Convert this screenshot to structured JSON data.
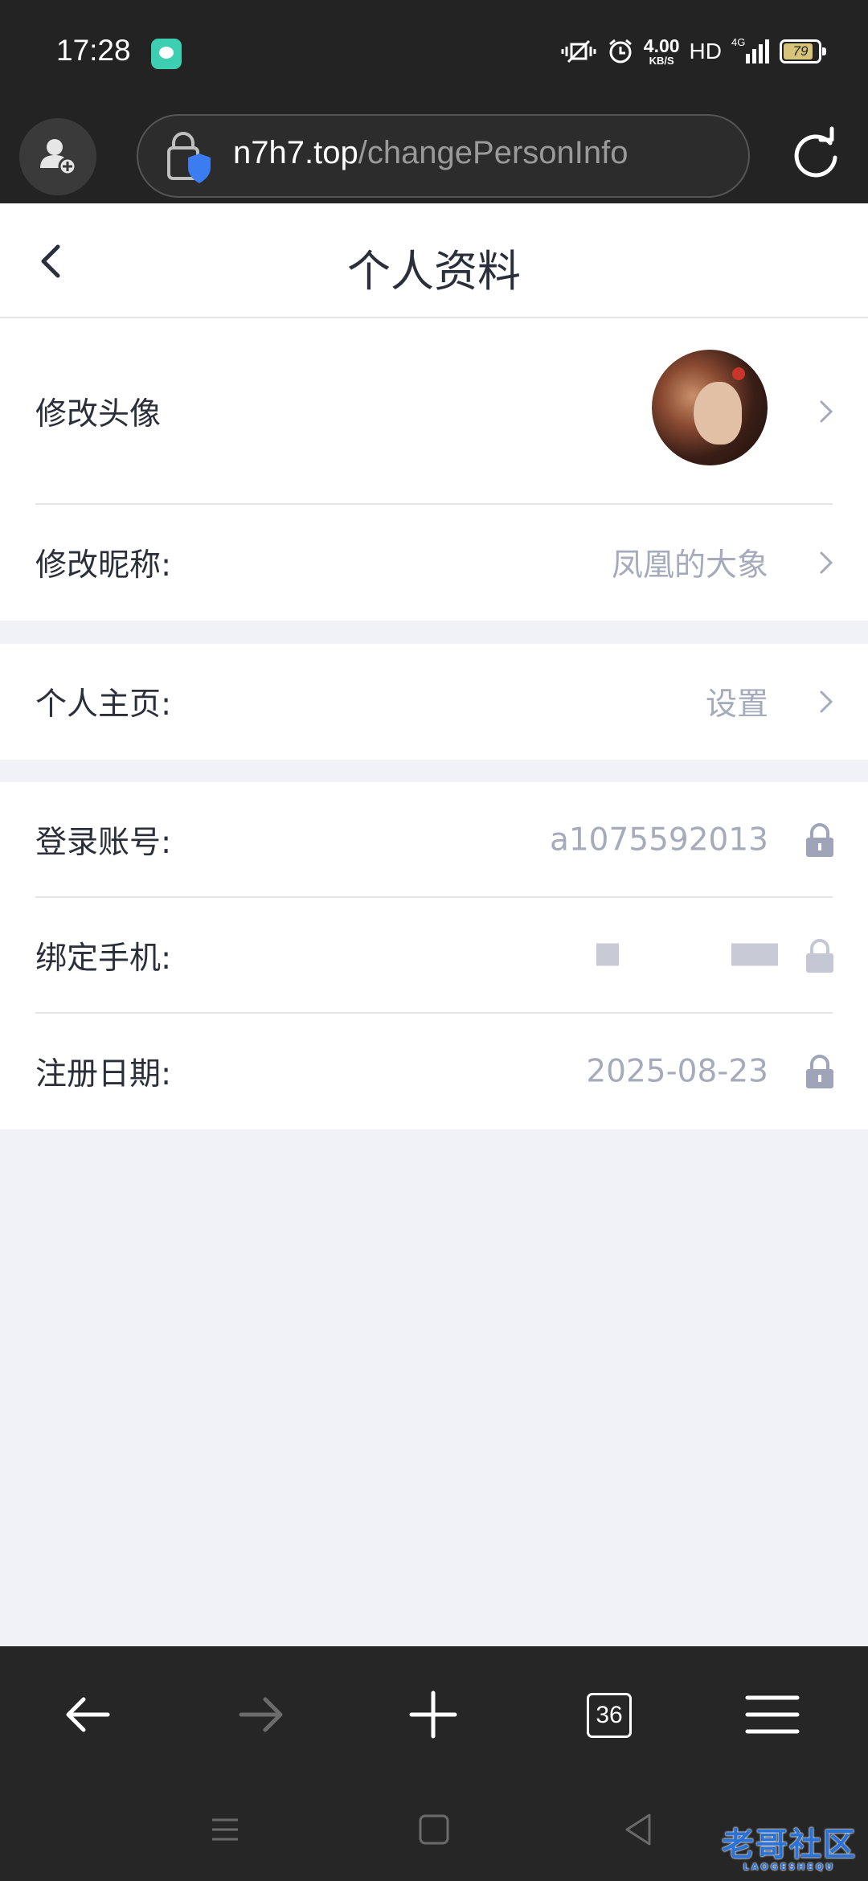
{
  "status_bar": {
    "time": "17:28",
    "network_speed": "4.00",
    "network_speed_unit": "KB/S",
    "hd_label": "HD",
    "signal_label": "4G",
    "battery_level": "79"
  },
  "browser": {
    "url_host": "n7h7.top",
    "url_path": "/changePersonInfo",
    "tab_count": "36"
  },
  "page": {
    "title": "个人资料"
  },
  "profile": {
    "avatar_label": "修改头像",
    "nickname_label": "修改昵称:",
    "nickname_value": "凤凰的大象",
    "homepage_label": "个人主页:",
    "homepage_value": "设置",
    "account_label": "登录账号:",
    "account_value": "a1075592013",
    "phone_label": "绑定手机:",
    "register_label": "注册日期:",
    "register_value": "2025-08-23"
  },
  "watermark": {
    "text": "老哥社区",
    "subtext": "LAOGESHEQU"
  },
  "colors": {
    "dark_bar": "#232323",
    "page_bg": "#f1f2f7",
    "value_gray": "#a6abbb",
    "lock_gray": "#9fa4b8",
    "shield_blue": "#3b7df0"
  }
}
